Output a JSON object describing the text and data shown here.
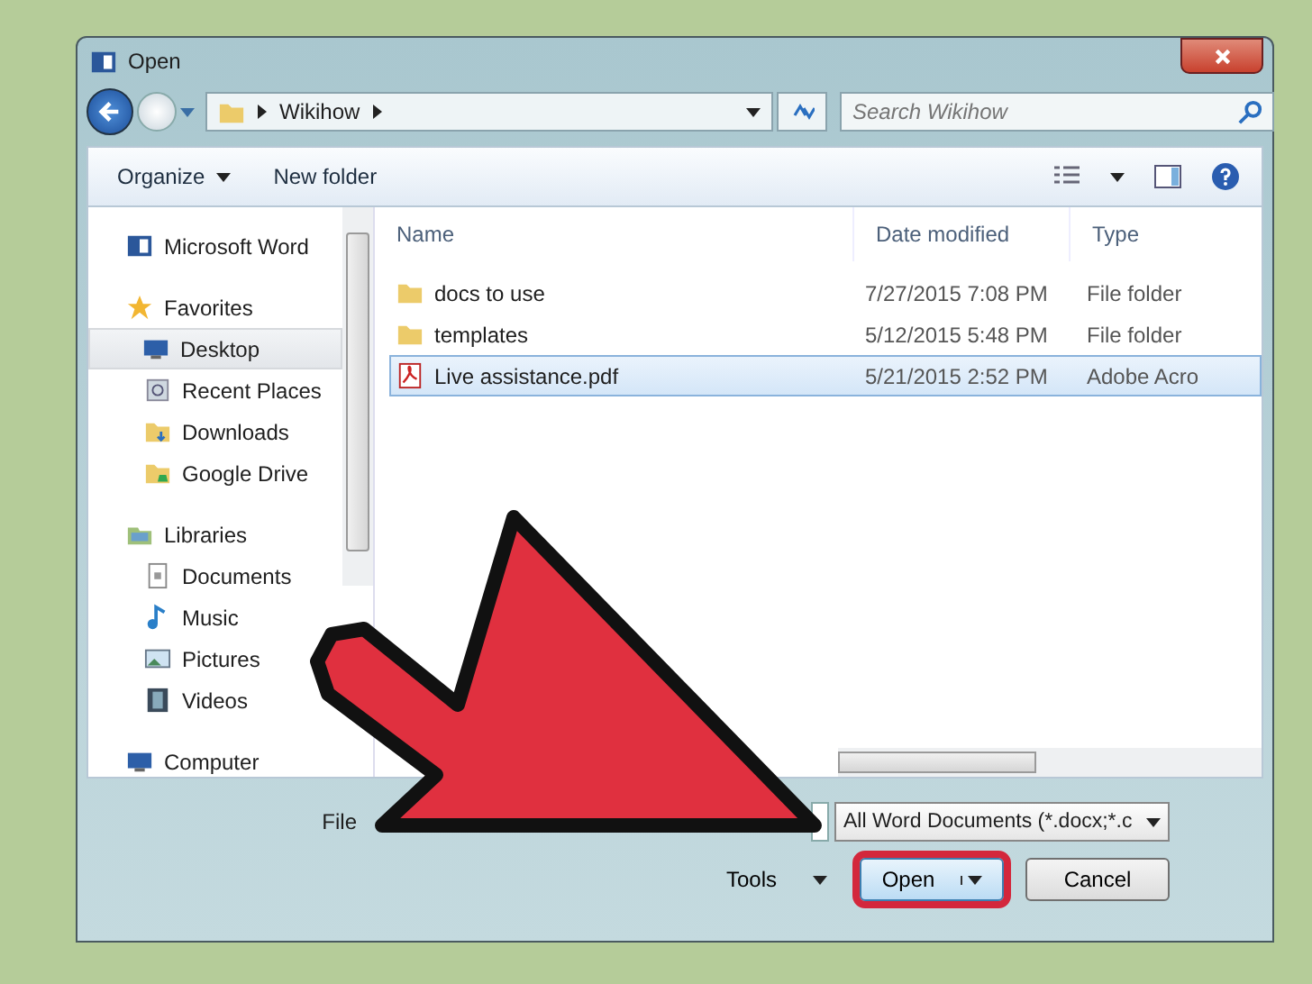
{
  "window": {
    "title": "Open"
  },
  "nav": {
    "path": [
      "Wikihow"
    ],
    "search": {
      "placeholder": "Search Wikihow"
    }
  },
  "toolbar": {
    "items": [
      {
        "label": "Organize",
        "dropdown": true
      },
      {
        "label": "New folder",
        "dropdown": false
      }
    ]
  },
  "sidebar": {
    "sections": [
      {
        "label": "Microsoft Word",
        "kind": "word",
        "selected": false
      },
      {
        "label": "Favorites",
        "kind": "star",
        "selected": false,
        "children": [
          {
            "label": "Desktop",
            "kind": "desktop",
            "selected": true
          },
          {
            "label": "Recent Places",
            "kind": "recent",
            "selected": false
          },
          {
            "label": "Downloads",
            "kind": "downloads",
            "selected": false
          },
          {
            "label": "Google Drive",
            "kind": "drive",
            "selected": false
          }
        ]
      },
      {
        "label": "Libraries",
        "kind": "library",
        "selected": false,
        "children": [
          {
            "label": "Documents",
            "kind": "documents",
            "selected": false
          },
          {
            "label": "Music",
            "kind": "music",
            "selected": false
          },
          {
            "label": "Pictures",
            "kind": "pictures",
            "selected": false
          },
          {
            "label": "Videos",
            "kind": "videos",
            "selected": false
          }
        ]
      },
      {
        "label": "Computer",
        "kind": "computer",
        "selected": false
      }
    ]
  },
  "table": {
    "columns": [
      "Name",
      "Date modified",
      "Type"
    ],
    "rows": [
      {
        "kind": "folder",
        "name": "docs to use",
        "date": "7/27/2015 7:08 PM",
        "type": "File folder",
        "selected": false
      },
      {
        "kind": "folder",
        "name": "templates",
        "date": "5/12/2015 5:48 PM",
        "type": "File folder",
        "selected": false
      },
      {
        "kind": "pdf",
        "name": "Live assistance.pdf",
        "date": "5/21/2015 2:52 PM",
        "type": "Adobe Acro",
        "selected": true
      }
    ]
  },
  "bottom": {
    "file_name_label": "File",
    "file_type": "All Word Documents (*.docx;*.c",
    "buttons": [
      {
        "label": "Tools",
        "kind": "menu",
        "highlighted": false
      },
      {
        "label": "Open",
        "kind": "split",
        "highlighted": true
      },
      {
        "label": "Cancel",
        "kind": "plain",
        "highlighted": false
      }
    ]
  }
}
